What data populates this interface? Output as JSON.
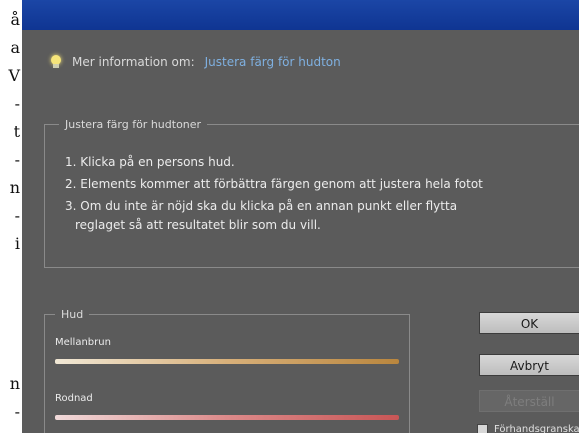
{
  "document": {
    "letters": [
      "å",
      "a",
      "V",
      "-",
      "t",
      "-",
      "n",
      "-",
      "i",
      "n",
      "-"
    ]
  },
  "dialog": {
    "info": {
      "prefix": "Mer information om:",
      "link": "Justera färg för hudton"
    },
    "instructions": {
      "legend": "Justera färg för hudtoner",
      "steps": [
        "1. Klicka på en persons hud.",
        "2. Elements kommer att förbättra färgen genom att justera hela fotot",
        "3. Om du inte är nöjd ska du klicka på en annan punkt eller flytta"
      ],
      "step3_continuation": "reglaget så att resultatet blir som du vill."
    },
    "hud": {
      "legend": "Hud",
      "slider1_label": "Mellanbrun",
      "slider2_label": "Rodnad"
    },
    "buttons": {
      "ok": "OK",
      "cancel": "Avbryt",
      "reset": "Återställ"
    },
    "preview_label": "Förhandsgranska"
  }
}
